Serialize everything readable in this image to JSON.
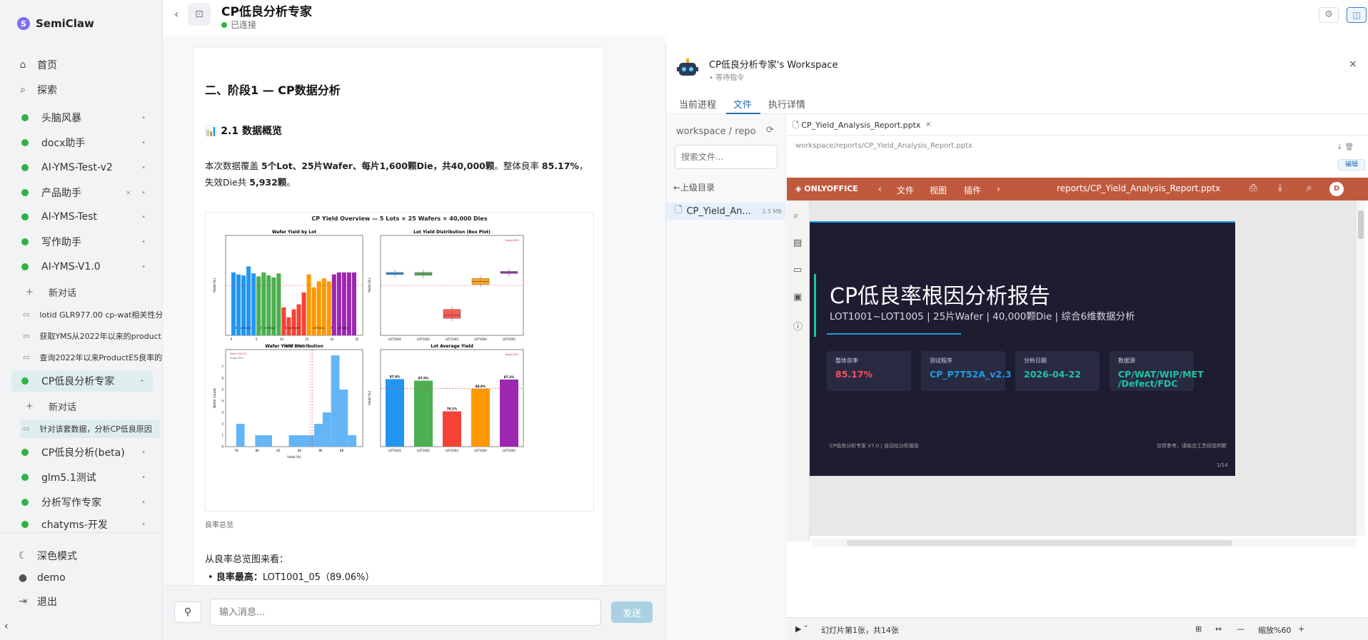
{
  "sidebar": {
    "brand": "SemiClaw",
    "nav": [
      {
        "label": "首页",
        "icon": "home-icon"
      },
      {
        "label": "探索",
        "icon": "search-icon"
      }
    ],
    "agents_top": [
      "头脑风暴",
      "docx助手",
      "AI-YMS-Test-v2",
      "产品助手",
      "AI-YMS-Test",
      "写作助手",
      "AI-YMS-V1.0"
    ],
    "new_chat": "新对话",
    "conversations_a": [
      "lotid GLR977.00 cp-wat相关性分析",
      "获取YMS从2022年以来的productE",
      "查询2022年以来ProductES良率的"
    ],
    "active_agent": "CP低良分析专家",
    "conversation_active": "针对该套数据，分析CP低良原因",
    "agents_bottom": [
      "CP低良分析(beta)",
      "glm5.1测试",
      "分析写作专家",
      "chatyms-开发"
    ],
    "dark_mode": "深色模式",
    "user": "demo",
    "logout": "退出"
  },
  "header": {
    "title": "CP低良分析专家",
    "status": "已连接"
  },
  "message": {
    "h2": "二、阶段1 — CP数据分析",
    "h3": "📊 2.1 数据概览",
    "para_1": "本次数据覆盖 ",
    "para_b1": "5个Lot、25片Wafer、每片1,600颗Die，共40,000颗",
    "para_2": "。整体良率 ",
    "para_b2": "85.17%",
    "para_3": "，失效Die共 ",
    "para_b3": "5,932颗",
    "para_4": "。",
    "figure_caption": "良率总览",
    "para2": "从良率总览图来看：",
    "bullet_label": "良率最高：",
    "bullet_value": "LOT1001_05（89.06%）"
  },
  "input": {
    "placeholder": "输入消息...",
    "send": "发送"
  },
  "workspace": {
    "title": "CP低良分析专家's Workspace",
    "status": "等待指令",
    "tabs": [
      "当前进程",
      "文件",
      "执行详情"
    ],
    "path_root": "workspace",
    "path_sep": "/",
    "path_dir": "repo",
    "search_placeholder": "搜索文件...",
    "up_dir": "←上级目录",
    "file_name": "CP_Yield_An...",
    "file_size": "1.5 MB",
    "viewer_tab": "CP_Yield_Analysis_Report.pptx",
    "viewer_path": "workspace/reports/CP_Yield_Analysis_Report.pptx",
    "edit": "编辑"
  },
  "onlyoffice": {
    "logo": "ONLYOFFICE",
    "menu": [
      "文件",
      "视图",
      "插件"
    ],
    "file": "reports/CP_Yield_Analysis_Report.pptx",
    "avatar": "D",
    "status_slide": "幻灯片第1张，共14张",
    "zoom": "缩放%60"
  },
  "slide": {
    "title": "CP低良率根因分析报告",
    "subtitle": "LOT1001~LOT1005 | 25片Wafer | 40,000颗Die | 综合6维数据分析",
    "cards": [
      {
        "key": "整体良率",
        "value": "85.17%",
        "color": "#ff4d5e"
      },
      {
        "key": "测试程序",
        "value": "CP_P7T52A_v2.3",
        "color": "#1e9de3"
      },
      {
        "key": "分析日期",
        "value": "2026-04-22",
        "color": "#1ec5a0"
      },
      {
        "key": "数据源",
        "value": "CP/WAT/WIP/MET /Defect/FDC",
        "color": "#1ec5a0"
      }
    ],
    "footer_left": "CP低良分析专家 V7.0 | 自动化分析报告",
    "footer_right": "仅供参考，请结合工艺经验判断",
    "page": "1/14"
  },
  "chart_data": {
    "title": "CP Yield Overview — 5 Lots × 25 Wafers × 40,000 Dies",
    "panels": [
      {
        "type": "bar",
        "title": "Wafer Yield by Lot",
        "xlabel": "Wafer index",
        "ylabel": "Yield (%)",
        "ylim": [
          75,
          95
        ],
        "x_ticks": [
          "0",
          "5",
          "10",
          "15",
          "20",
          "25"
        ],
        "series": [
          {
            "name": "LOT1001",
            "color": "#2196f3",
            "values": [
              87.6,
              87.2,
              87.0,
              88.8,
              87.4
            ]
          },
          {
            "name": "LOT1002",
            "color": "#4caf50",
            "values": [
              86.8,
              87.6,
              87.0,
              86.6,
              87.4
            ]
          },
          {
            "name": "LOT1003",
            "color": "#f44336",
            "values": [
              80.6,
              78.6,
              80.2,
              81.2,
              83.6
            ]
          },
          {
            "name": "LOT1004",
            "color": "#ff9800",
            "values": [
              87.2,
              84.6,
              85.8,
              86.4,
              85.8
            ]
          },
          {
            "name": "LOT1005",
            "color": "#9c27b0",
            "values": [
              87.2,
              87.6,
              87.6,
              87.6,
              87.6
            ]
          }
        ],
        "threshold": 85
      },
      {
        "type": "box",
        "title": "Lot Yield Distribution (Box Plot)",
        "ylabel": "Yield (%)",
        "ylim": [
          75,
          95
        ],
        "categories": [
          "LOT1001",
          "LOT1002",
          "LOT1003",
          "LOT1004",
          "LOT1005"
        ],
        "colors": [
          "#2196f3",
          "#4caf50",
          "#f44336",
          "#ff9800",
          "#9c27b0"
        ],
        "medians": [
          87.4,
          87.3,
          79.0,
          85.8,
          87.6
        ],
        "q1": [
          87.2,
          87.0,
          78.4,
          85.2,
          87.4
        ],
        "q3": [
          87.6,
          87.6,
          80.2,
          86.4,
          87.8
        ],
        "threshold": 85,
        "legend": "Target 85%"
      },
      {
        "type": "bar",
        "title": "Wafer Yield Distribution",
        "xlabel": "Yield (%)",
        "ylabel": "Wafer Count",
        "xlim": [
          77,
          90
        ],
        "x_ticks": [
          "78",
          "80",
          "82",
          "84",
          "86",
          "88"
        ],
        "y_ticks": [
          "0",
          "1",
          "2",
          "3",
          "4",
          "5",
          "6",
          "7"
        ],
        "bins": [
          {
            "x": 78.4,
            "count": 2
          },
          {
            "x": 79.6,
            "count": 0
          },
          {
            "x": 80.2,
            "count": 1
          },
          {
            "x": 81.0,
            "count": 1
          },
          {
            "x": 81.8,
            "count": 0
          },
          {
            "x": 82.6,
            "count": 0
          },
          {
            "x": 83.4,
            "count": 1
          },
          {
            "x": 84.2,
            "count": 1
          },
          {
            "x": 85.0,
            "count": 1
          },
          {
            "x": 85.8,
            "count": 2
          },
          {
            "x": 86.6,
            "count": 3
          },
          {
            "x": 87.4,
            "count": 8
          },
          {
            "x": 88.2,
            "count": 5
          },
          {
            "x": 89.0,
            "count": 1
          }
        ],
        "legend": [
          "Mean=85.2%",
          "Target 85%"
        ]
      },
      {
        "type": "bar",
        "title": "Lot Average Yield",
        "ylabel": "Yield (%)",
        "ylim": [
          70,
          95
        ],
        "categories": [
          "LOT1001",
          "LOT1002",
          "LOT1003",
          "LOT1004",
          "LOT1005"
        ],
        "colors": [
          "#2196f3",
          "#4caf50",
          "#f44336",
          "#ff9800",
          "#9c27b0"
        ],
        "values": [
          87.4,
          87.0,
          79.1,
          84.9,
          87.3
        ],
        "labels": [
          "87.4%",
          "87.0%",
          "79.1%",
          "84.9%",
          "87.3%"
        ],
        "threshold": 85,
        "legend": "Target 85%"
      }
    ]
  }
}
